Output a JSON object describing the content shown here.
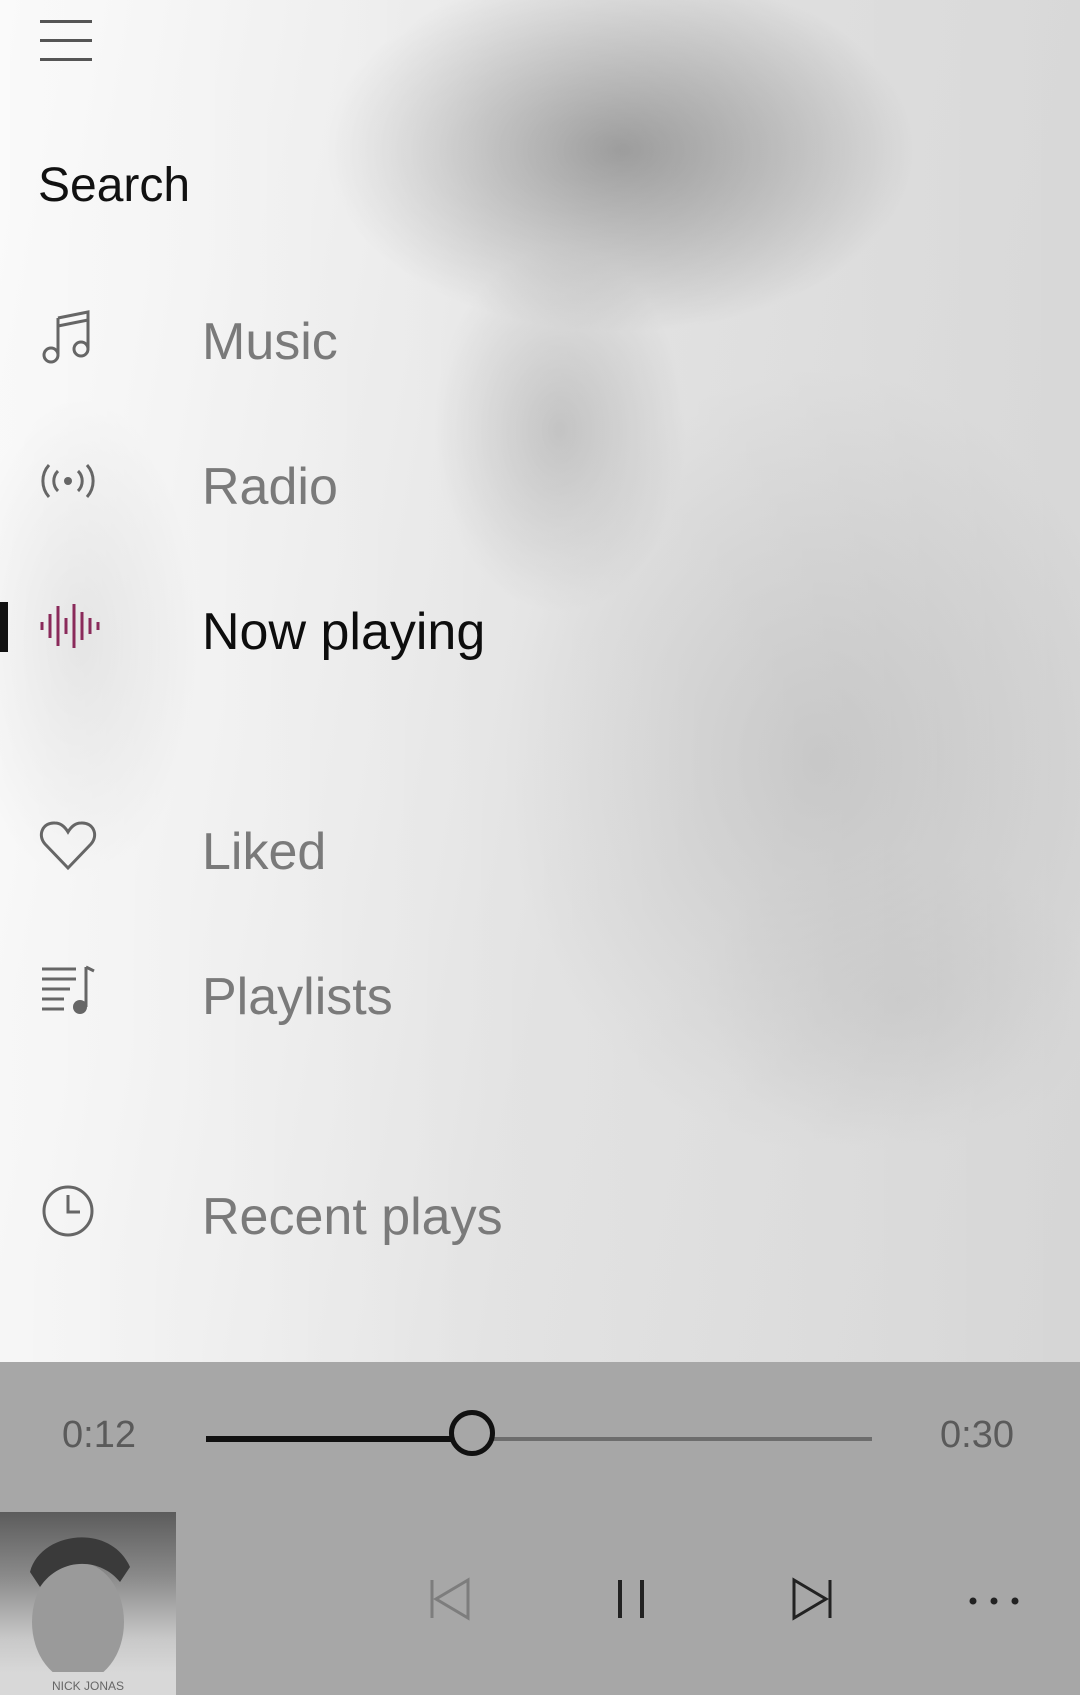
{
  "nav": {
    "search_label": "Search",
    "items": [
      {
        "label": "Music",
        "icon": "music-note-icon",
        "active": false
      },
      {
        "label": "Radio",
        "icon": "radio-icon",
        "active": false
      },
      {
        "label": "Now playing",
        "icon": "waveform-icon",
        "active": true
      },
      {
        "label": "Liked",
        "icon": "heart-icon",
        "active": false
      },
      {
        "label": "Playlists",
        "icon": "playlist-icon",
        "active": false
      },
      {
        "label": "Recent plays",
        "icon": "clock-icon",
        "active": false
      }
    ]
  },
  "player": {
    "elapsed": "0:12",
    "duration": "0:30",
    "progress": 0.4,
    "album_art_text": "NICK JONAS",
    "controls": [
      "previous-icon",
      "pause-icon",
      "next-icon",
      "more-icon"
    ]
  },
  "colors": {
    "accent_wave": "#8a2a5a",
    "player_bg": "#a7a7a7"
  }
}
